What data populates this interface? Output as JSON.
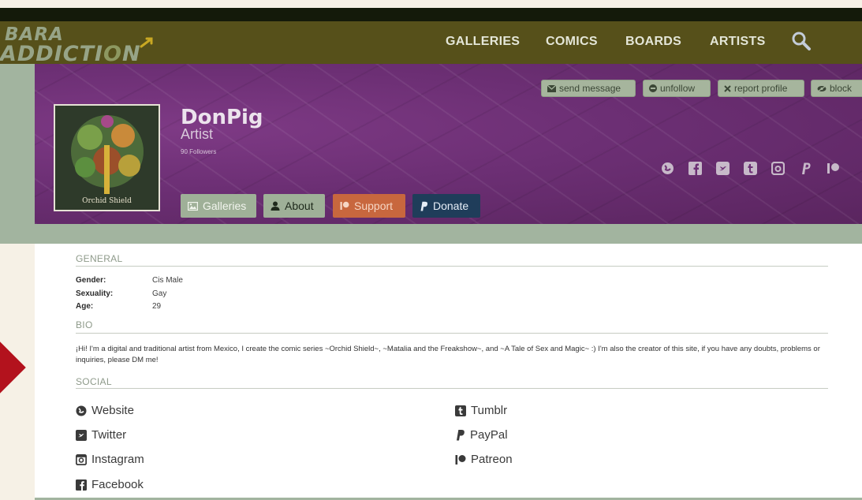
{
  "nav": {
    "logo_line1": "BARA",
    "logo_line2_a": "ADDICTI",
    "logo_line2_o": "O",
    "logo_line2_b": "N",
    "links": [
      "GALLERIES",
      "COMICS",
      "BOARDS",
      "ARTISTS"
    ],
    "search_icon": "search-icon"
  },
  "profile": {
    "name": "DonPig",
    "role": "Artist",
    "followers": "90 Followers",
    "avatar_caption": "Orchid Shield"
  },
  "actions": {
    "send_message": "send message",
    "unfollow": "unfollow",
    "report_profile": "report profile",
    "block": "block"
  },
  "tabs": {
    "galleries": "Galleries",
    "about": "About",
    "support": "Support",
    "donate": "Donate"
  },
  "general": {
    "title": "GENERAL",
    "fields": [
      {
        "label": "Gender:",
        "value": "Cis Male"
      },
      {
        "label": "Sexuality:",
        "value": "Gay"
      },
      {
        "label": "Age:",
        "value": "29"
      }
    ]
  },
  "bio": {
    "title": "BIO",
    "text": "¡Hi! I'm a digital and traditional artist from Mexico, I create the comic series ~Orchid Shield~, ~Matalia and the Freakshow~, and ~A Tale of Sex and Magic~ :) I'm also the creator of this site, if you have any doubts, problems or inquiries, please DM me!"
  },
  "social": {
    "title": "SOCIAL",
    "website": "Website",
    "twitter": "Twitter",
    "instagram": "Instagram",
    "facebook": "Facebook",
    "tumblr": "Tumblr",
    "paypal": "PayPal",
    "patreon": "Patreon"
  },
  "colors": {
    "nav_bg": "#56501a",
    "banner": "#6c2f74",
    "accent_green": "#a2b49f",
    "support": "#c8673e",
    "donate": "#1f3d5a"
  }
}
